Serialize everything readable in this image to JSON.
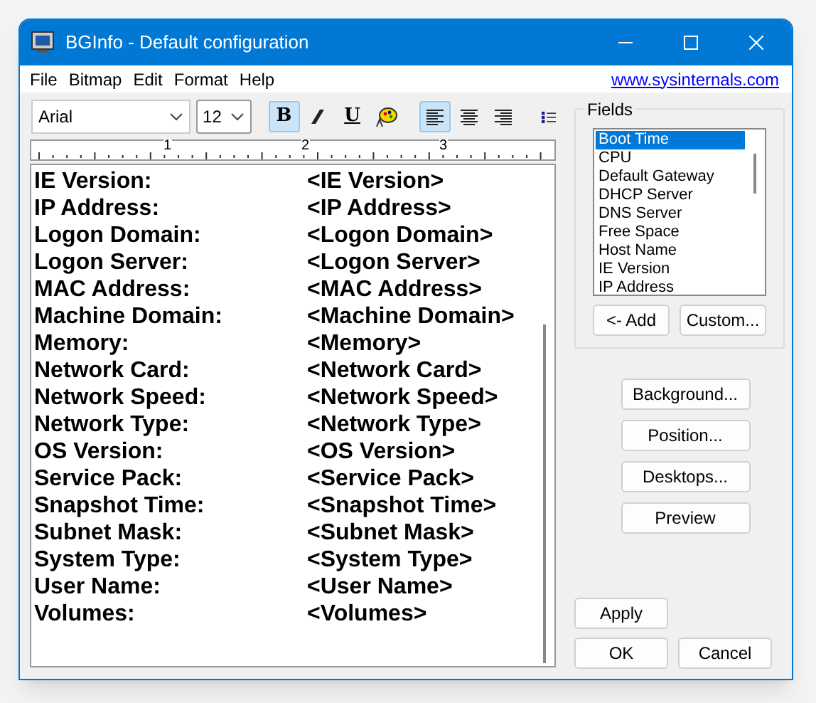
{
  "window": {
    "title": "BGInfo - Default configuration"
  },
  "menu": [
    "File",
    "Bitmap",
    "Edit",
    "Format",
    "Help"
  ],
  "link": "www.sysinternals.com",
  "toolbar": {
    "font": "Arial",
    "size": "12",
    "styles": [
      {
        "kind": "bold",
        "label": "B",
        "selected": true
      },
      {
        "kind": "italic",
        "selected": false
      },
      {
        "kind": "underline",
        "label": "U",
        "selected": false
      },
      {
        "kind": "color",
        "selected": false
      }
    ],
    "aligns": [
      {
        "kind": "left",
        "selected": true
      },
      {
        "kind": "center",
        "selected": false
      },
      {
        "kind": "right",
        "selected": false
      }
    ]
  },
  "ruler": [
    "1",
    "2",
    "3"
  ],
  "rows": [
    {
      "label": "IE Version:",
      "value": "<IE Version>"
    },
    {
      "label": "IP Address:",
      "value": "<IP Address>"
    },
    {
      "label": "Logon Domain:",
      "value": "<Logon Domain>"
    },
    {
      "label": "Logon Server:",
      "value": "<Logon Server>"
    },
    {
      "label": "MAC Address:",
      "value": "<MAC Address>"
    },
    {
      "label": "Machine Domain:",
      "value": "<Machine Domain>"
    },
    {
      "label": "Memory:",
      "value": "<Memory>"
    },
    {
      "label": "Network Card:",
      "value": "<Network Card>"
    },
    {
      "label": "Network Speed:",
      "value": "<Network Speed>"
    },
    {
      "label": "Network Type:",
      "value": "<Network Type>"
    },
    {
      "label": "OS Version:",
      "value": "<OS Version>"
    },
    {
      "label": "Service Pack:",
      "value": "<Service Pack>"
    },
    {
      "label": "Snapshot Time:",
      "value": "<Snapshot Time>"
    },
    {
      "label": "Subnet Mask:",
      "value": "<Subnet Mask>"
    },
    {
      "label": "System Type:",
      "value": "<System Type>"
    },
    {
      "label": "User Name:",
      "value": "<User Name>"
    },
    {
      "label": "Volumes:",
      "value": "<Volumes>"
    }
  ],
  "fields": {
    "title": "Fields",
    "items": [
      {
        "label": "Boot Time",
        "selected": true
      },
      {
        "label": "CPU",
        "selected": false
      },
      {
        "label": "Default Gateway",
        "selected": false
      },
      {
        "label": "DHCP Server",
        "selected": false
      },
      {
        "label": "DNS Server",
        "selected": false
      },
      {
        "label": "Free Space",
        "selected": false
      },
      {
        "label": "Host Name",
        "selected": false
      },
      {
        "label": "IE Version",
        "selected": false
      },
      {
        "label": "IP Address",
        "selected": false
      }
    ],
    "buttons": [
      "<- Add",
      "Custom..."
    ]
  },
  "side_buttons": [
    "Background...",
    "Position...",
    "Desktops...",
    "Preview"
  ],
  "apply": "Apply",
  "ok": "OK",
  "cancel": "Cancel"
}
